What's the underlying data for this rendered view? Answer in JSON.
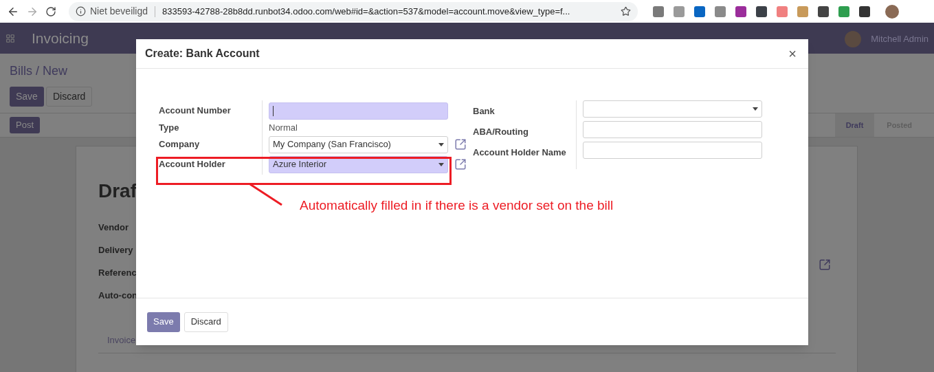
{
  "browser": {
    "security": "Niet beveiligd",
    "url": "833593-42788-28b8dd.runbot34.odoo.com/web#id=&action=537&model=account.move&view_type=f..."
  },
  "navbar": {
    "app_title": "Invoicing",
    "user": "Mitchell Admin"
  },
  "control_panel": {
    "breadcrumb": "Bills / New",
    "buttons": [
      {
        "label": "Save",
        "kind": "primary"
      },
      {
        "label": "Discard",
        "kind": "secondary"
      }
    ],
    "action_button": "Post",
    "statusbar": [
      {
        "label": "Draft",
        "selected": true
      },
      {
        "label": "Posted",
        "selected": false
      }
    ]
  },
  "sheet": {
    "title": "Draf",
    "fields": [
      "Vendor",
      "Delivery",
      "Referenc",
      "Auto-con"
    ],
    "tab": "Invoice"
  },
  "dialog": {
    "title": "Create: Bank Account",
    "close": "×",
    "left_fields": [
      {
        "label": "Account Number",
        "kind": "input",
        "required": true,
        "focused": true,
        "link": false
      },
      {
        "label": "Type",
        "kind": "text",
        "value": "Normal",
        "required": false,
        "link": false
      },
      {
        "label": "Company",
        "kind": "select",
        "value": "My Company (San Francisco)",
        "required": false,
        "link": true
      },
      {
        "label": "Account Holder",
        "kind": "select",
        "value": "Azure Interior",
        "required": true,
        "link": true
      }
    ],
    "right_fields": [
      {
        "label": "Bank",
        "kind": "select",
        "required": false
      },
      {
        "label": "ABA/Routing",
        "kind": "input",
        "required": false
      },
      {
        "label": "Account Holder Name",
        "kind": "input",
        "required": false
      }
    ],
    "buttons": [
      {
        "label": "Save",
        "kind": "primary"
      },
      {
        "label": "Discard",
        "kind": "secondary"
      }
    ]
  },
  "annotation": "Automatically filled in if there is a vendor set on the bill"
}
